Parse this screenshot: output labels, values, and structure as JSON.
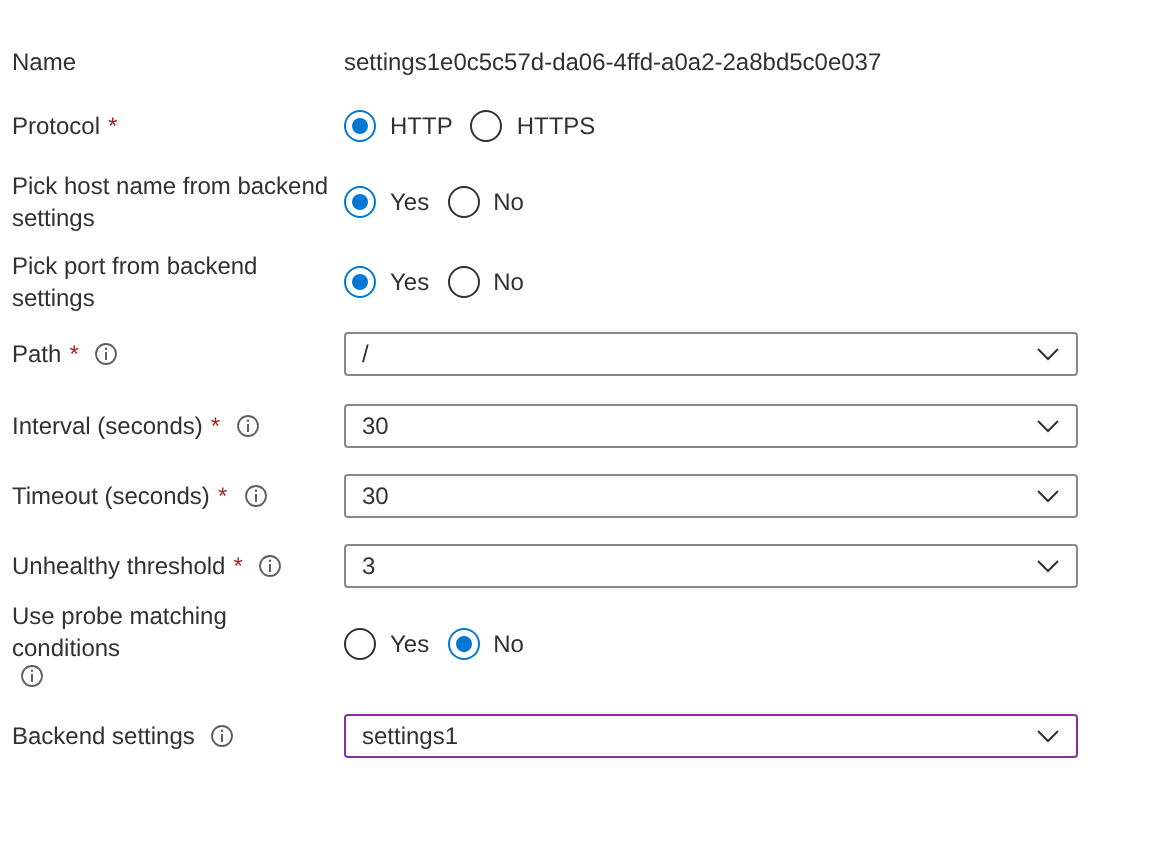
{
  "fields": [
    {
      "kind": "text",
      "label": "Name",
      "info": false,
      "value": "settings1e0c5c57d-da06-4ffd-a0a2-2a8bd5c0e037"
    },
    {
      "kind": "radio",
      "label": "Protocol",
      "required_mark": "*",
      "info": false,
      "options": [
        {
          "label": "HTTP",
          "selected": true
        },
        {
          "label": "HTTPS",
          "selected": false
        }
      ]
    },
    {
      "kind": "radio",
      "label": "Pick host name from backend settings",
      "info": false,
      "options": [
        {
          "label": "Yes",
          "selected": true
        },
        {
          "label": "No",
          "selected": false
        }
      ]
    },
    {
      "kind": "radio",
      "label": "Pick port from backend settings",
      "info": false,
      "options": [
        {
          "label": "Yes",
          "selected": true
        },
        {
          "label": "No",
          "selected": false
        }
      ]
    },
    {
      "kind": "dropdown",
      "label": "Path",
      "required_mark": "*",
      "info": true,
      "value": "/",
      "focused": false
    },
    {
      "kind": "dropdown",
      "label": "Interval (seconds)",
      "required_mark": "*",
      "info": true,
      "value": "30",
      "focused": false
    },
    {
      "kind": "dropdown",
      "label": "Timeout (seconds)",
      "required_mark": "*",
      "info": true,
      "value": "30",
      "focused": false
    },
    {
      "kind": "dropdown",
      "label": "Unhealthy threshold",
      "required_mark": "*",
      "info": true,
      "value": "3",
      "focused": false
    },
    {
      "kind": "radio",
      "label": "Use probe matching conditions",
      "info": true,
      "options": [
        {
          "label": "Yes",
          "selected": false
        },
        {
          "label": "No",
          "selected": true
        }
      ]
    },
    {
      "kind": "dropdown",
      "label": "Backend settings",
      "info": true,
      "value": "settings1",
      "focused": true
    }
  ]
}
